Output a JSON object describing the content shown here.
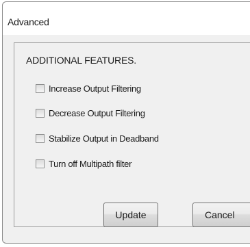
{
  "window": {
    "title": "Advanced"
  },
  "panel": {
    "heading": "ADDITIONAL FEATURES.",
    "options": [
      {
        "label": "Increase Output Filtering",
        "checked": false
      },
      {
        "label": "Decrease Output Filtering",
        "checked": false
      },
      {
        "label": "Stabilize Output in Deadband",
        "checked": false
      },
      {
        "label": "Turn off Multipath filter",
        "checked": false
      }
    ]
  },
  "buttons": {
    "update_label": "Update",
    "cancel_label": "Cancel"
  }
}
